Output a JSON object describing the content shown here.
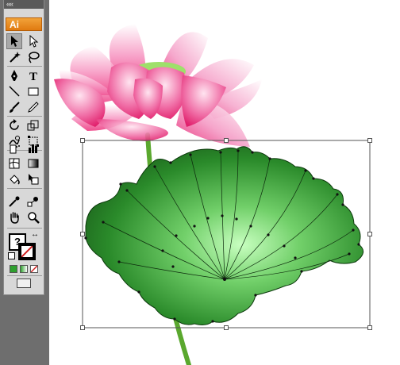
{
  "app": {
    "collapse_glyph": "««",
    "logo_label": "Ai",
    "logo_color": "#f08a1c"
  },
  "toolbox": {
    "tools": [
      {
        "name": "selection-tool-icon",
        "selected": true
      },
      {
        "name": "direct-selection-tool-icon"
      },
      {
        "name": "magic-wand-tool-icon"
      },
      {
        "name": "lasso-tool-icon"
      },
      {
        "name": "pen-tool-icon"
      },
      {
        "name": "type-tool-icon",
        "label": "T"
      },
      {
        "name": "line-segment-tool-icon"
      },
      {
        "name": "rectangle-tool-icon"
      },
      {
        "name": "paintbrush-tool-icon"
      },
      {
        "name": "pencil-tool-icon"
      },
      {
        "name": "rotate-tool-icon"
      },
      {
        "name": "scale-tool-icon"
      },
      {
        "name": "warp-tool-icon"
      },
      {
        "name": "free-transform-tool-icon"
      },
      {
        "name": "symbol-sprayer-tool-icon"
      },
      {
        "name": "column-graph-tool-icon"
      },
      {
        "name": "mesh-tool-icon"
      },
      {
        "name": "gradient-tool-icon"
      },
      {
        "name": "eyedropper-tool-icon"
      },
      {
        "name": "blend-tool-icon"
      },
      {
        "name": "live-paint-bucket-tool-icon"
      },
      {
        "name": "live-paint-selection-tool-icon"
      },
      {
        "name": "slice-tool-icon"
      },
      {
        "name": "eraser-tool-icon"
      },
      {
        "name": "hand-tool-icon"
      },
      {
        "name": "zoom-tool-icon"
      }
    ],
    "fill_stroke": {
      "fill_label": "?",
      "swap_glyph": "↔",
      "fill_color": "#ffffff",
      "stroke_color": "#d02020"
    },
    "color_modes": [
      "#2ea02e",
      "#7cc07c",
      "#ffffff"
    ],
    "screen_mode": "normal"
  },
  "artwork": {
    "lotus_petal_color": "#ec2f7a",
    "lotus_highlight": "#ffffff",
    "seedpod_color": "#9ee06a",
    "stem_color": "#5aa82e",
    "leaf_dark": "#1f6a1f",
    "leaf_light": "#c8ffc0",
    "selection_box_color": "#555555"
  }
}
